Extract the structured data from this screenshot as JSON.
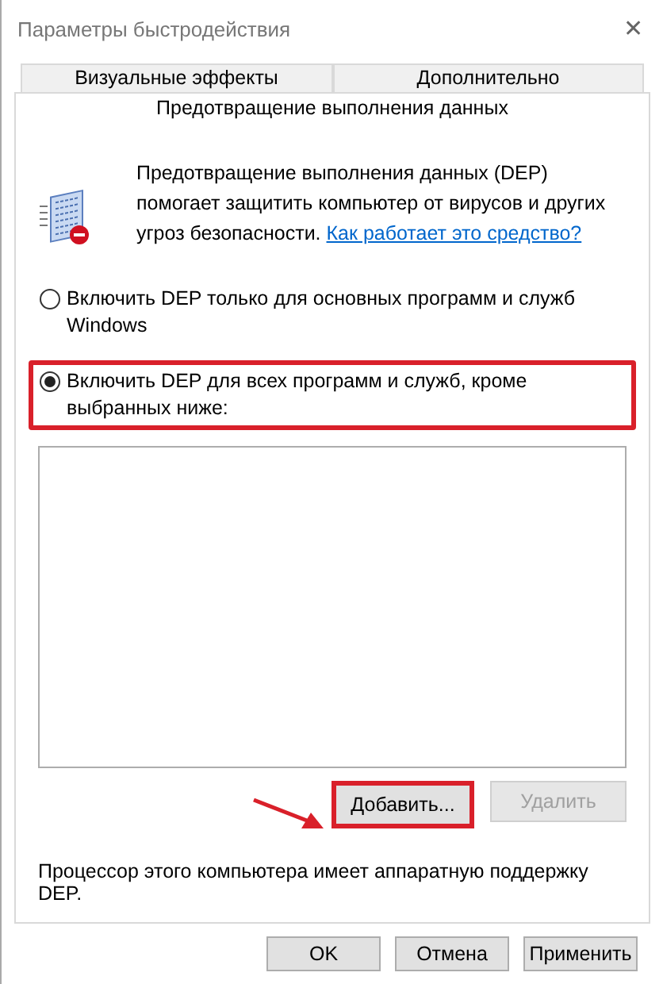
{
  "window": {
    "title": "Параметры быстродействия",
    "close": "✕"
  },
  "tabs": [
    {
      "label": "Визуальные эффекты",
      "selected": false
    },
    {
      "label": "Дополнительно",
      "selected": false
    },
    {
      "label": "Предотвращение выполнения данных",
      "selected": true
    }
  ],
  "intro": {
    "text": "Предотвращение выполнения данных (DEP) помогает защитить компьютер от вирусов и других угроз безопасности.",
    "link": "Как работает это средство?"
  },
  "options": [
    {
      "label": "Включить DEP только для основных программ и служб Windows",
      "selected": false,
      "highlighted": false
    },
    {
      "label": "Включить DEP для всех программ и служб, кроме выбранных ниже:",
      "selected": true,
      "highlighted": true
    }
  ],
  "list_buttons": [
    {
      "label": "Добавить...",
      "disabled": false,
      "highlighted": true
    },
    {
      "label": "Удалить",
      "disabled": true,
      "highlighted": false
    }
  ],
  "status": "Процессор этого компьютера имеет аппаратную поддержку DEP.",
  "buttons": [
    "OK",
    "Отмена",
    "Применить"
  ]
}
